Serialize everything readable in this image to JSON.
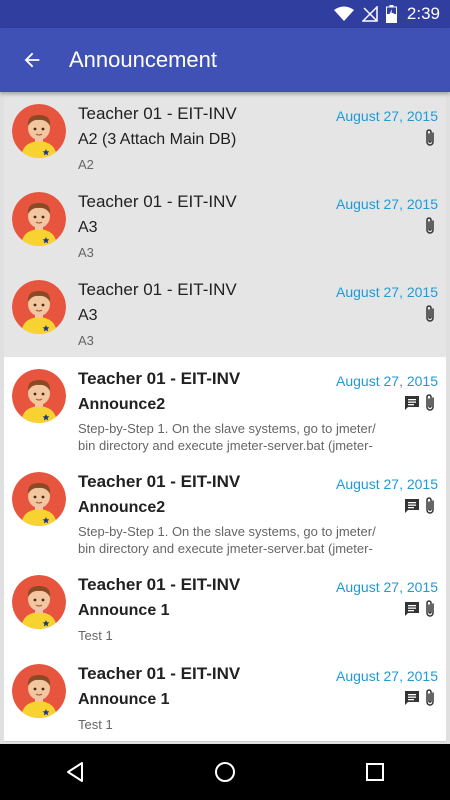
{
  "status_bar": {
    "time": "2:39"
  },
  "app_bar": {
    "title": "Announcement"
  },
  "announcements": [
    {
      "sender": "Teacher 01 - EIT-INV",
      "date": "August 27, 2015",
      "subject": "A2 (3 Attach Main DB)",
      "preview": "A2",
      "read": true,
      "has_comment": false,
      "has_attachment": true
    },
    {
      "sender": "Teacher 01 - EIT-INV",
      "date": "August 27, 2015",
      "subject": "A3",
      "preview": "A3",
      "read": true,
      "has_comment": false,
      "has_attachment": true
    },
    {
      "sender": "Teacher 01 - EIT-INV",
      "date": "August 27, 2015",
      "subject": "A3",
      "preview": "A3",
      "read": true,
      "has_comment": false,
      "has_attachment": true
    },
    {
      "sender": "Teacher 01 - EIT-INV",
      "date": "August 27, 2015",
      "subject": "Announce2",
      "preview": "Step-by-Step 1. On the slave systems, go to jmeter/ bin directory and execute jmeter-server.bat (jmeter-",
      "read": false,
      "has_comment": true,
      "has_attachment": true
    },
    {
      "sender": "Teacher 01 - EIT-INV",
      "date": "August 27, 2015",
      "subject": "Announce2",
      "preview": "Step-by-Step 1. On the slave systems, go to jmeter/ bin directory and execute jmeter-server.bat (jmeter-",
      "read": false,
      "has_comment": true,
      "has_attachment": true
    },
    {
      "sender": "Teacher 01 - EIT-INV",
      "date": "August 27, 2015",
      "subject": "Announce 1",
      "preview": "Test 1",
      "read": false,
      "has_comment": true,
      "has_attachment": true
    },
    {
      "sender": "Teacher 01 - EIT-INV",
      "date": "August 27, 2015",
      "subject": "Announce 1",
      "preview": "Test 1",
      "read": false,
      "has_comment": true,
      "has_attachment": true
    }
  ],
  "colors": {
    "primary": "#3f51b5",
    "primary_dark": "#303f9f",
    "date": "#1e9ad6",
    "avatar_bg": "#e8553f",
    "avatar_shirt": "#f7d332"
  }
}
